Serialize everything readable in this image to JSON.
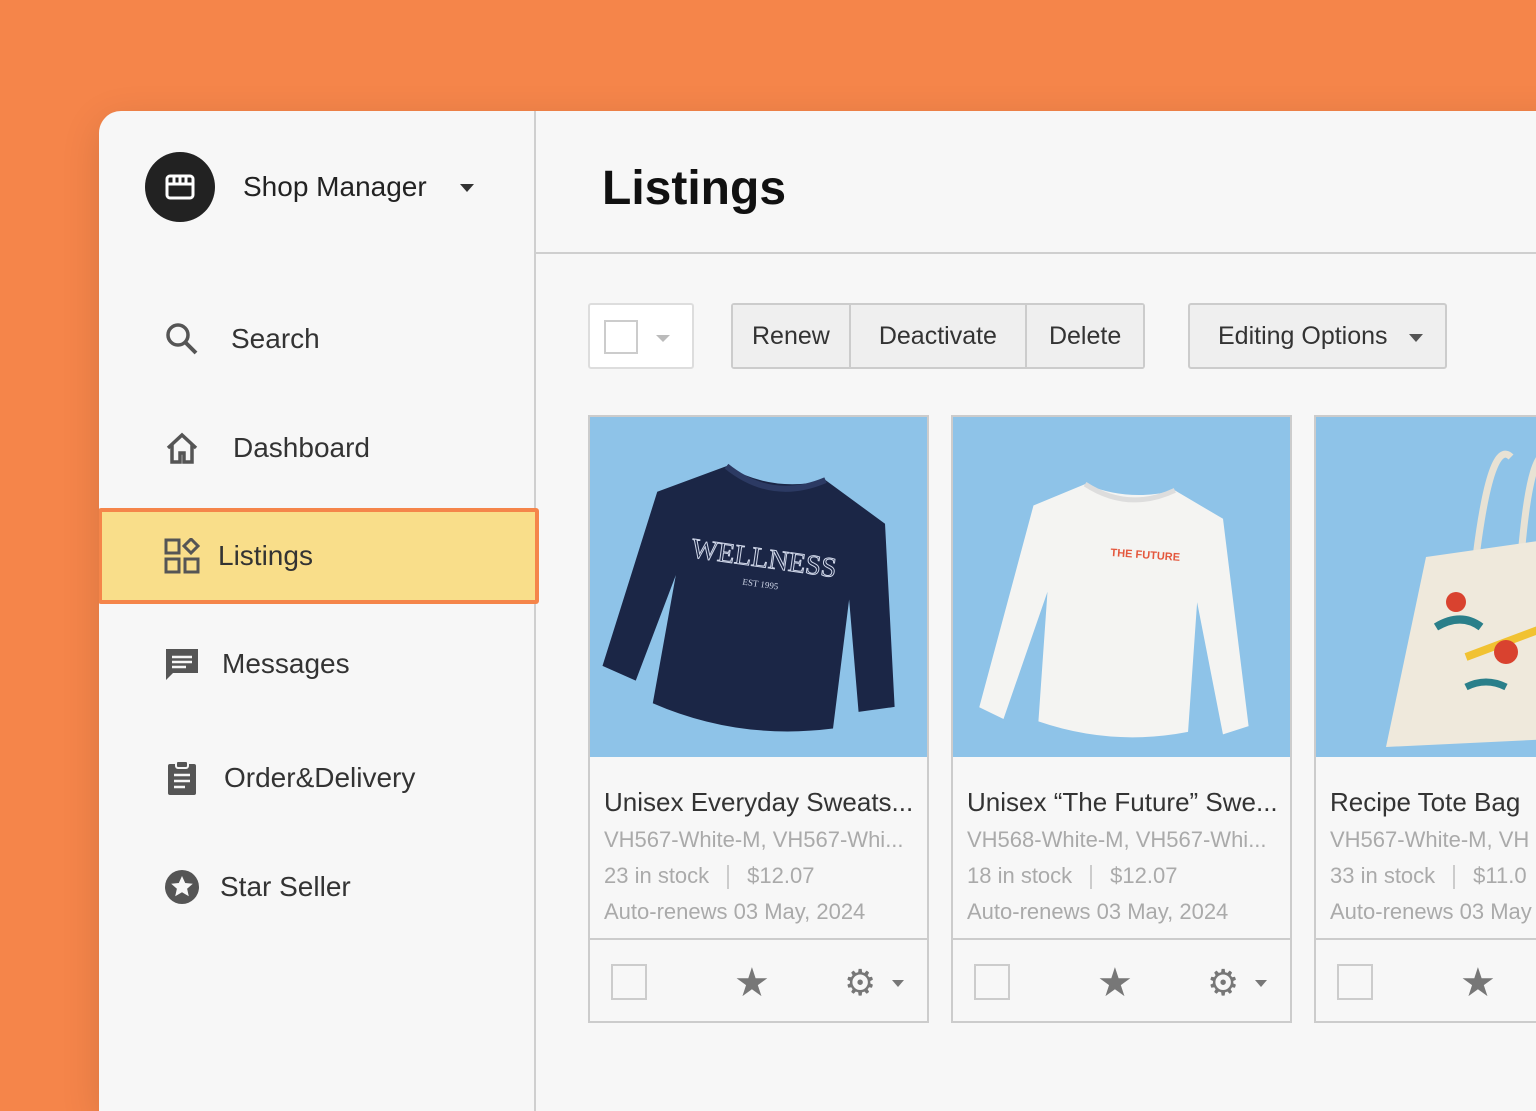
{
  "sidebar": {
    "shop_name": "Shop Manager",
    "items": [
      {
        "label": "Search",
        "icon": "search-icon"
      },
      {
        "label": "Dashboard",
        "icon": "home-icon"
      },
      {
        "label": "Listings",
        "icon": "listings-icon",
        "active": true
      },
      {
        "label": "Messages",
        "icon": "message-icon"
      },
      {
        "label": "Order&Delivery",
        "icon": "clipboard-icon"
      },
      {
        "label": "Star Seller",
        "icon": "star-badge-icon"
      }
    ]
  },
  "header": {
    "title": "Listings"
  },
  "toolbar": {
    "renew": "Renew",
    "deactivate": "Deactivate",
    "delete": "Delete",
    "editing_options": "Editing Options"
  },
  "listings": [
    {
      "name": "Unisex Everyday Sweats...",
      "sku": "VH567-White-M, VH567-Whi...",
      "stock": "23 in stock",
      "price": "$12.07",
      "renew": "Auto-renews 03 May, 2024",
      "image": "navy sweatshirt",
      "print": "WELLNESS",
      "print2": "EST 1995"
    },
    {
      "name": "Unisex “The Future” Swe...",
      "sku": "VH568-White-M, VH567-Whi...",
      "stock": "18 in stock",
      "price": "$12.07",
      "renew": "Auto-renews 03 May, 2024",
      "image": "white sweatshirt",
      "print": "THE FUTURE"
    },
    {
      "name": "Recipe Tote Bag",
      "sku": "VH567-White-M, VH",
      "stock": "33 in stock",
      "price": "$11.0",
      "renew": "Auto-renews 03 May",
      "image": "tote bag"
    }
  ],
  "colors": {
    "background": "#F5854A",
    "active_item": "#F9DE8A",
    "image_bg": "#8EC3E8"
  }
}
